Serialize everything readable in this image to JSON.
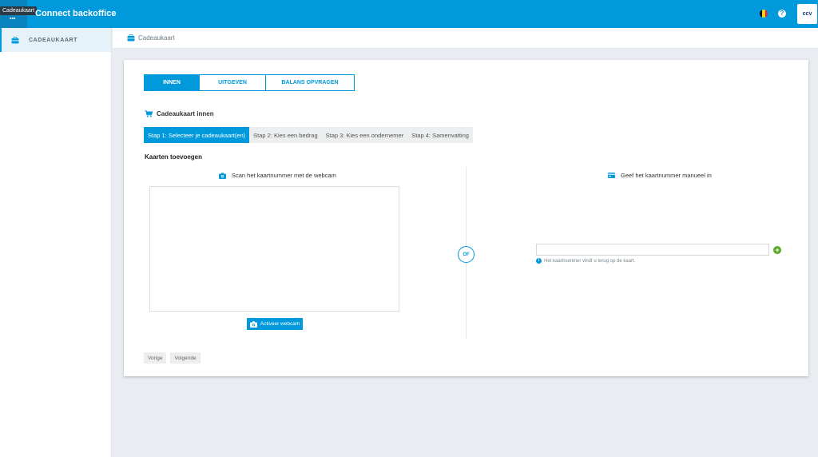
{
  "topbar": {
    "app_switcher_tooltip": "Cadeaukaart",
    "title": "Connect backoffice",
    "language_flag": "belgium-flag-icon",
    "help_label": "?",
    "logo_text": "ccv"
  },
  "sidebar": {
    "items": [
      {
        "label": "CADEAUKAART",
        "icon": "giftcard-icon"
      }
    ]
  },
  "breadcrumb": {
    "items": [
      "Cadeaukaart"
    ]
  },
  "tabs": [
    {
      "label": "INNEN",
      "active": true
    },
    {
      "label": "UITGEVEN",
      "active": false
    },
    {
      "label": "BALANS OPVRAGEN",
      "active": false
    }
  ],
  "section": {
    "title": "Cadeaukaart innen",
    "icon": "cart-icon"
  },
  "steps": [
    {
      "label": "Stap 1: Selecteer je cadeaukaart(en)",
      "active": true
    },
    {
      "label": "Stap 2: Kies een bedrag",
      "active": false
    },
    {
      "label": "Stap 3: Kies een ondernemer",
      "active": false
    },
    {
      "label": "Stap 4: Samenvatting",
      "active": false
    }
  ],
  "subheading": "Kaarten toevoegen",
  "scan": {
    "header": "Scan het kaartnummer met de webcam",
    "button_label": "Activeer webcam"
  },
  "or_label": "OF",
  "manual": {
    "header": "Geef het kaartnummer manueel in",
    "input_value": "",
    "add_label": "+",
    "hint": "Het kaartnummer vindt u terug op de kaart."
  },
  "navigation": {
    "prev_label": "Vorige",
    "next_label": "Volgende"
  },
  "colors": {
    "brand": "#0099db",
    "add": "#5ba829"
  }
}
